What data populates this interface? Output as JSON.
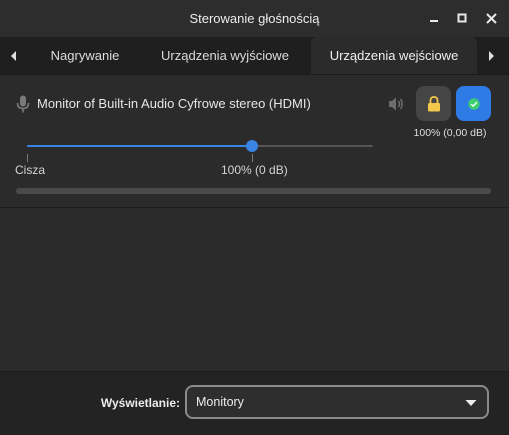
{
  "window": {
    "title": "Sterowanie głośnością",
    "buttons": [
      "minimize-icon",
      "maximize-icon",
      "close-icon"
    ]
  },
  "tabs": {
    "items": [
      {
        "label": "Nagrywanie",
        "active": false
      },
      {
        "label": "Urządzenia wyjściowe",
        "active": false
      },
      {
        "label": "Urządzenia wejściowe",
        "active": true
      }
    ],
    "scroll_left_icon": "chevron-left-icon",
    "scroll_right_icon": "chevron-right-icon"
  },
  "device": {
    "name": "Monitor of Built-in Audio Cyfrowe stereo (HDMI)",
    "volume_readout": "100% (0,00 dB)",
    "volume_fraction": 0.65,
    "marks": {
      "silence": "Cisza",
      "unity": "100% (0 dB)"
    },
    "peak_fraction": 0.0,
    "icons": {
      "device": "microphone-icon",
      "mute": "speaker-icon",
      "lock": "lock-icon",
      "default": "checkmark-icon"
    }
  },
  "footer": {
    "filter_label": "Wyświetlanie:",
    "filter_value": "Monitory"
  },
  "colors": {
    "accent": "#2f7be5",
    "lock": "#f2c94c",
    "background": "#2b2b2b"
  }
}
